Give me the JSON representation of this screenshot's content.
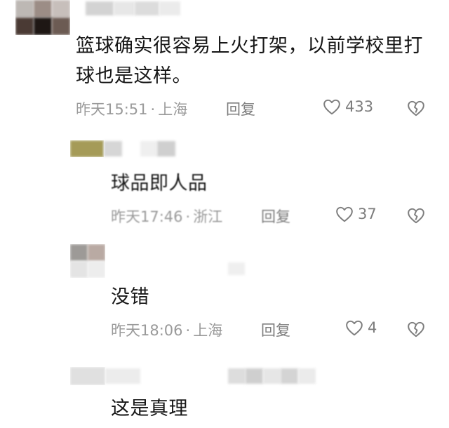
{
  "comments": [
    {
      "text": "篮球确实很容易上火打架，以前学校里打球也是这样。",
      "time": "昨天15:51",
      "location": "上海",
      "reply_label": "回复",
      "likes": "433"
    },
    {
      "text": "球品即人品",
      "time": "昨天17:46",
      "location": "浙江",
      "reply_label": "回复",
      "likes": "37"
    },
    {
      "text": "没错",
      "time": "昨天18:06",
      "location": "上海",
      "reply_label": "回复",
      "likes": "4"
    },
    {
      "text": "这是真理"
    }
  ],
  "separator": "·",
  "icons": {
    "like": "heart-outline-icon",
    "dislike": "broken-heart-icon"
  },
  "colors": {
    "text": "#161616",
    "meta": "#9a9a9a",
    "icon": "#7d7d7d"
  }
}
